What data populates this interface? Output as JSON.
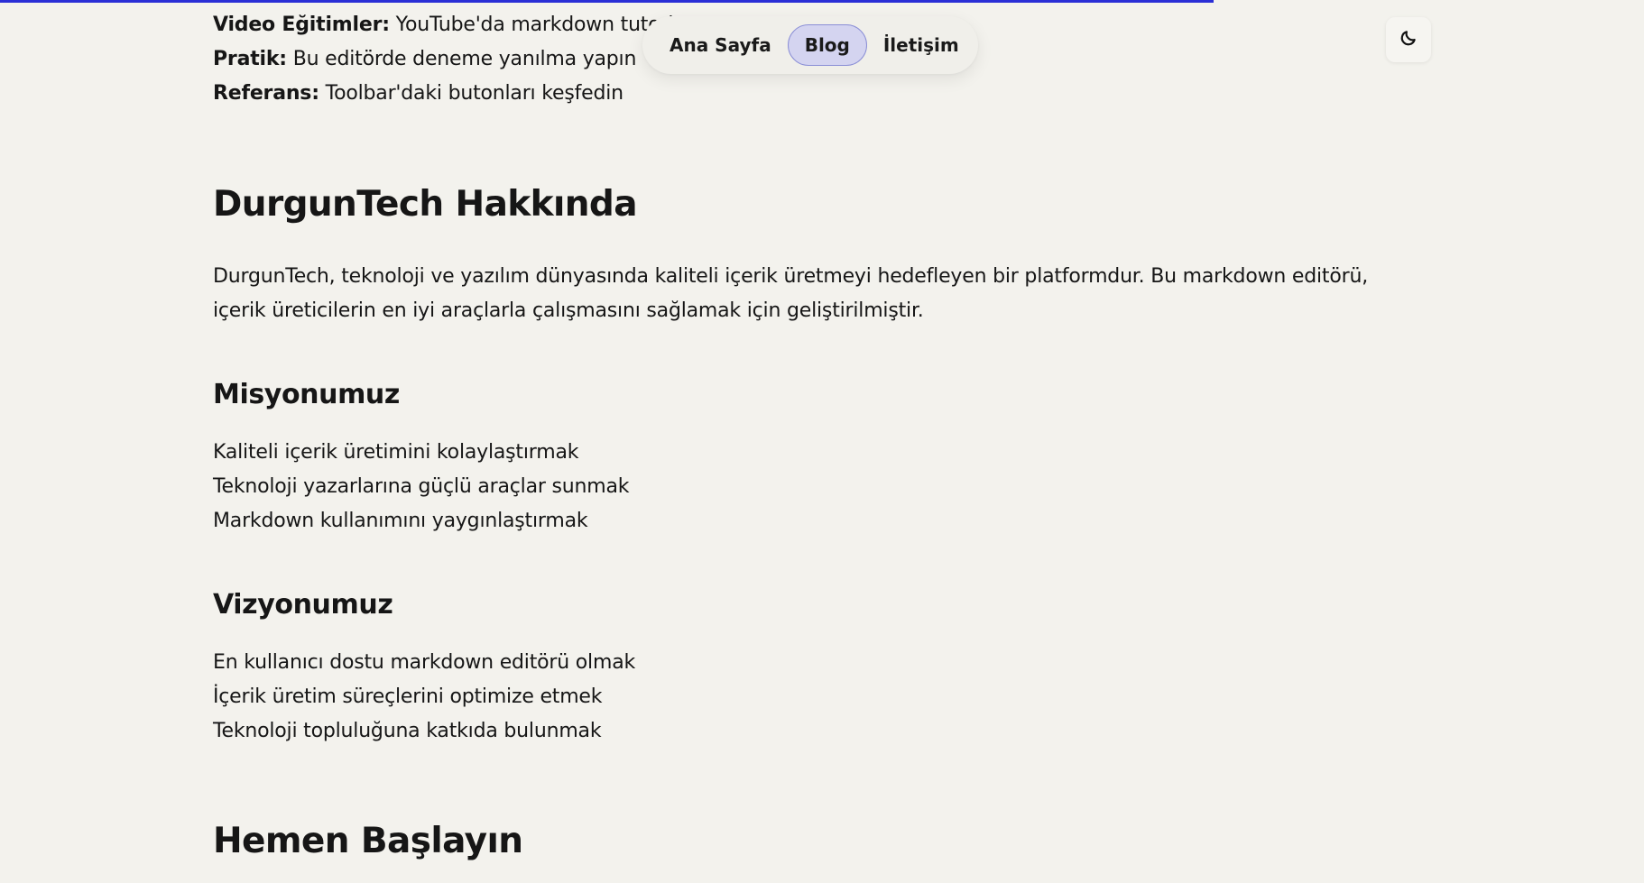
{
  "progress": {
    "percent": 73.8,
    "color": "#2a2fd6"
  },
  "top_list": [
    {
      "label": "Video Eğitimler:",
      "text": "YouTube'da markdown tutoria"
    },
    {
      "label": "Pratik:",
      "text": "Bu editörde deneme yanılma yapın"
    },
    {
      "label": "Referans:",
      "text": "Toolbar'daki butonları keşfedin"
    }
  ],
  "nav": {
    "items": [
      {
        "label": "Ana Sayfa"
      },
      {
        "label": "Blog"
      },
      {
        "label": "İletişim"
      }
    ],
    "active_index": 1
  },
  "theme_toggle": {
    "icon": "moon-icon"
  },
  "about": {
    "title": "DurgunTech Hakkında",
    "paragraph": "DurgunTech, teknoloji ve yazılım dünyasında kaliteli içerik üretmeyi hedefleyen bir platformdur. Bu markdown editörü, içerik üreticilerin en iyi araçlarla çalışmasını sağlamak için geliştirilmiştir."
  },
  "mission": {
    "title": "Misyonumuz",
    "items": [
      "Kaliteli içerik üretimini kolaylaştırmak",
      "Teknoloji yazarlarına güçlü araçlar sunmak",
      "Markdown kullanımını yaygınlaştırmak"
    ]
  },
  "vision": {
    "title": "Vizyonumuz",
    "items": [
      "En kullanıcı dostu markdown editörü olmak",
      "İçerik üretim süreçlerini optimize etmek",
      "Teknoloji topluluğuna katkıda bulunmak"
    ]
  },
  "start": {
    "title": "Hemen Başlayın"
  }
}
